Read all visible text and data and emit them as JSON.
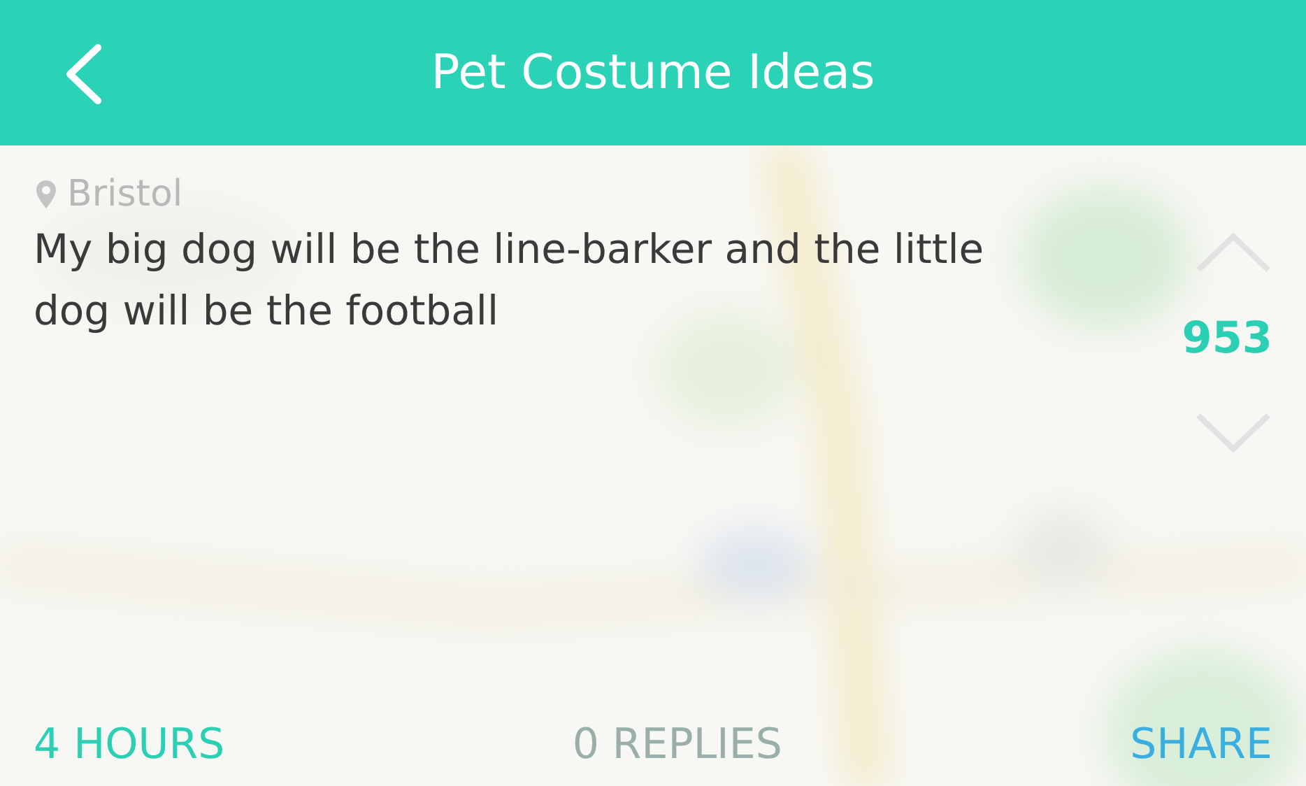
{
  "header": {
    "title": "Pet Costume Ideas"
  },
  "post": {
    "location": "Bristol",
    "text": "My big dog will be the line-barker and the little dog will be the football"
  },
  "votes": {
    "count": "953"
  },
  "footer": {
    "time": "4 HOURS",
    "replies": "0 REPLIES",
    "share": "SHARE"
  }
}
